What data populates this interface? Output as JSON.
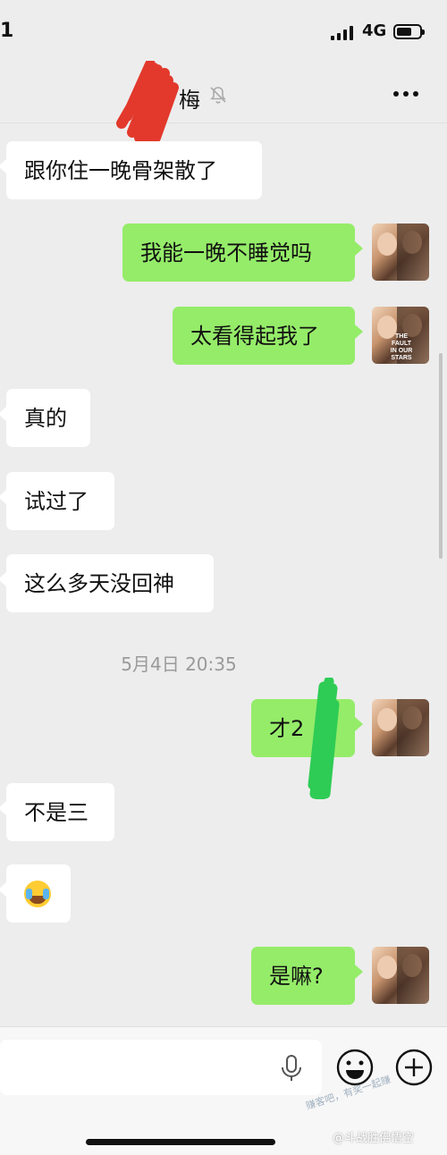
{
  "status_bar": {
    "time": "1",
    "network": "4G",
    "battery_level": 0.65
  },
  "nav": {
    "title": "梅"
  },
  "messages": [
    {
      "side": "in",
      "text": "跟你住一晚骨架散了"
    },
    {
      "side": "out",
      "text": "我能一晚不睡觉吗"
    },
    {
      "side": "out",
      "text": "太看得起我了"
    },
    {
      "side": "in",
      "text": "真的"
    },
    {
      "side": "in",
      "text": "试过了"
    },
    {
      "side": "in",
      "text": "这么多天没回神"
    },
    {
      "side": "out",
      "text": "才2"
    },
    {
      "side": "in",
      "text": "不是三"
    },
    {
      "side": "in",
      "text": "",
      "emoji": "crying-laughing-emoji"
    },
    {
      "side": "out",
      "text": "是嘛?"
    }
  ],
  "timestamp": "5月4日 20:35",
  "avatar_title": "THE FAULT IN OUR STARS",
  "input": {
    "value": "",
    "placeholder": ""
  },
  "icons": {
    "mute": "bell-mute-icon",
    "more": "more-dots-icon",
    "mic": "microphone-icon",
    "emoji": "smiley-icon",
    "plus": "plus-circle-icon"
  },
  "watermark": {
    "line1": "赚客吧，有奖一起赚",
    "line2": "@斗战胜佛悟空"
  },
  "colors": {
    "outgoing_bubble": "#95ec69",
    "incoming_bubble": "#ffffff",
    "background": "#ededed"
  }
}
